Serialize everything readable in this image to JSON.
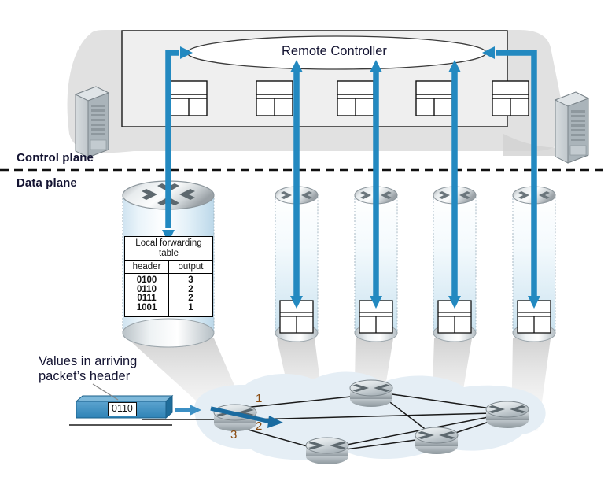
{
  "figure": {
    "title": "SDN control plane and data plane diagram"
  },
  "control_plane": {
    "label": "Control plane",
    "controller_label": "Remote Controller",
    "controller_shape": "ellipse",
    "server_count": 2,
    "table_icon_count": 5,
    "box_fill": "#efefef",
    "box_border": "#1a1a1a"
  },
  "data_plane": {
    "label": "Data plane",
    "cylinder_count": 5,
    "arrow_color": "#2389c0"
  },
  "forwarding_table": {
    "title": "Local forwarding\ntable",
    "title_line1": "Local forwarding",
    "title_line2": "table",
    "columns": [
      "header",
      "output"
    ],
    "rows": [
      {
        "header": "0100",
        "output": "3"
      },
      {
        "header": "0110",
        "output": "2"
      },
      {
        "header": "0111",
        "output": "2"
      },
      {
        "header": "1001",
        "output": "1"
      }
    ]
  },
  "packet_callout": {
    "line1": "Values in arriving",
    "line2": "packet’s header",
    "packet_value": "0110",
    "packet_color": "#3b8fc4"
  },
  "network": {
    "port_labels": [
      "1",
      "2",
      "3"
    ],
    "port_color": "#8a4b10",
    "router_count": 5,
    "cloud_fill": "#e5eef5",
    "highlight_arrow_color": "#1a6ba0"
  },
  "colors": {
    "accent_blue": "#2389c0",
    "dark_text": "#141432",
    "table_border": "#000000",
    "beam_gray": "#d8d8d8",
    "cylinder_top": "#c9cdd0"
  }
}
